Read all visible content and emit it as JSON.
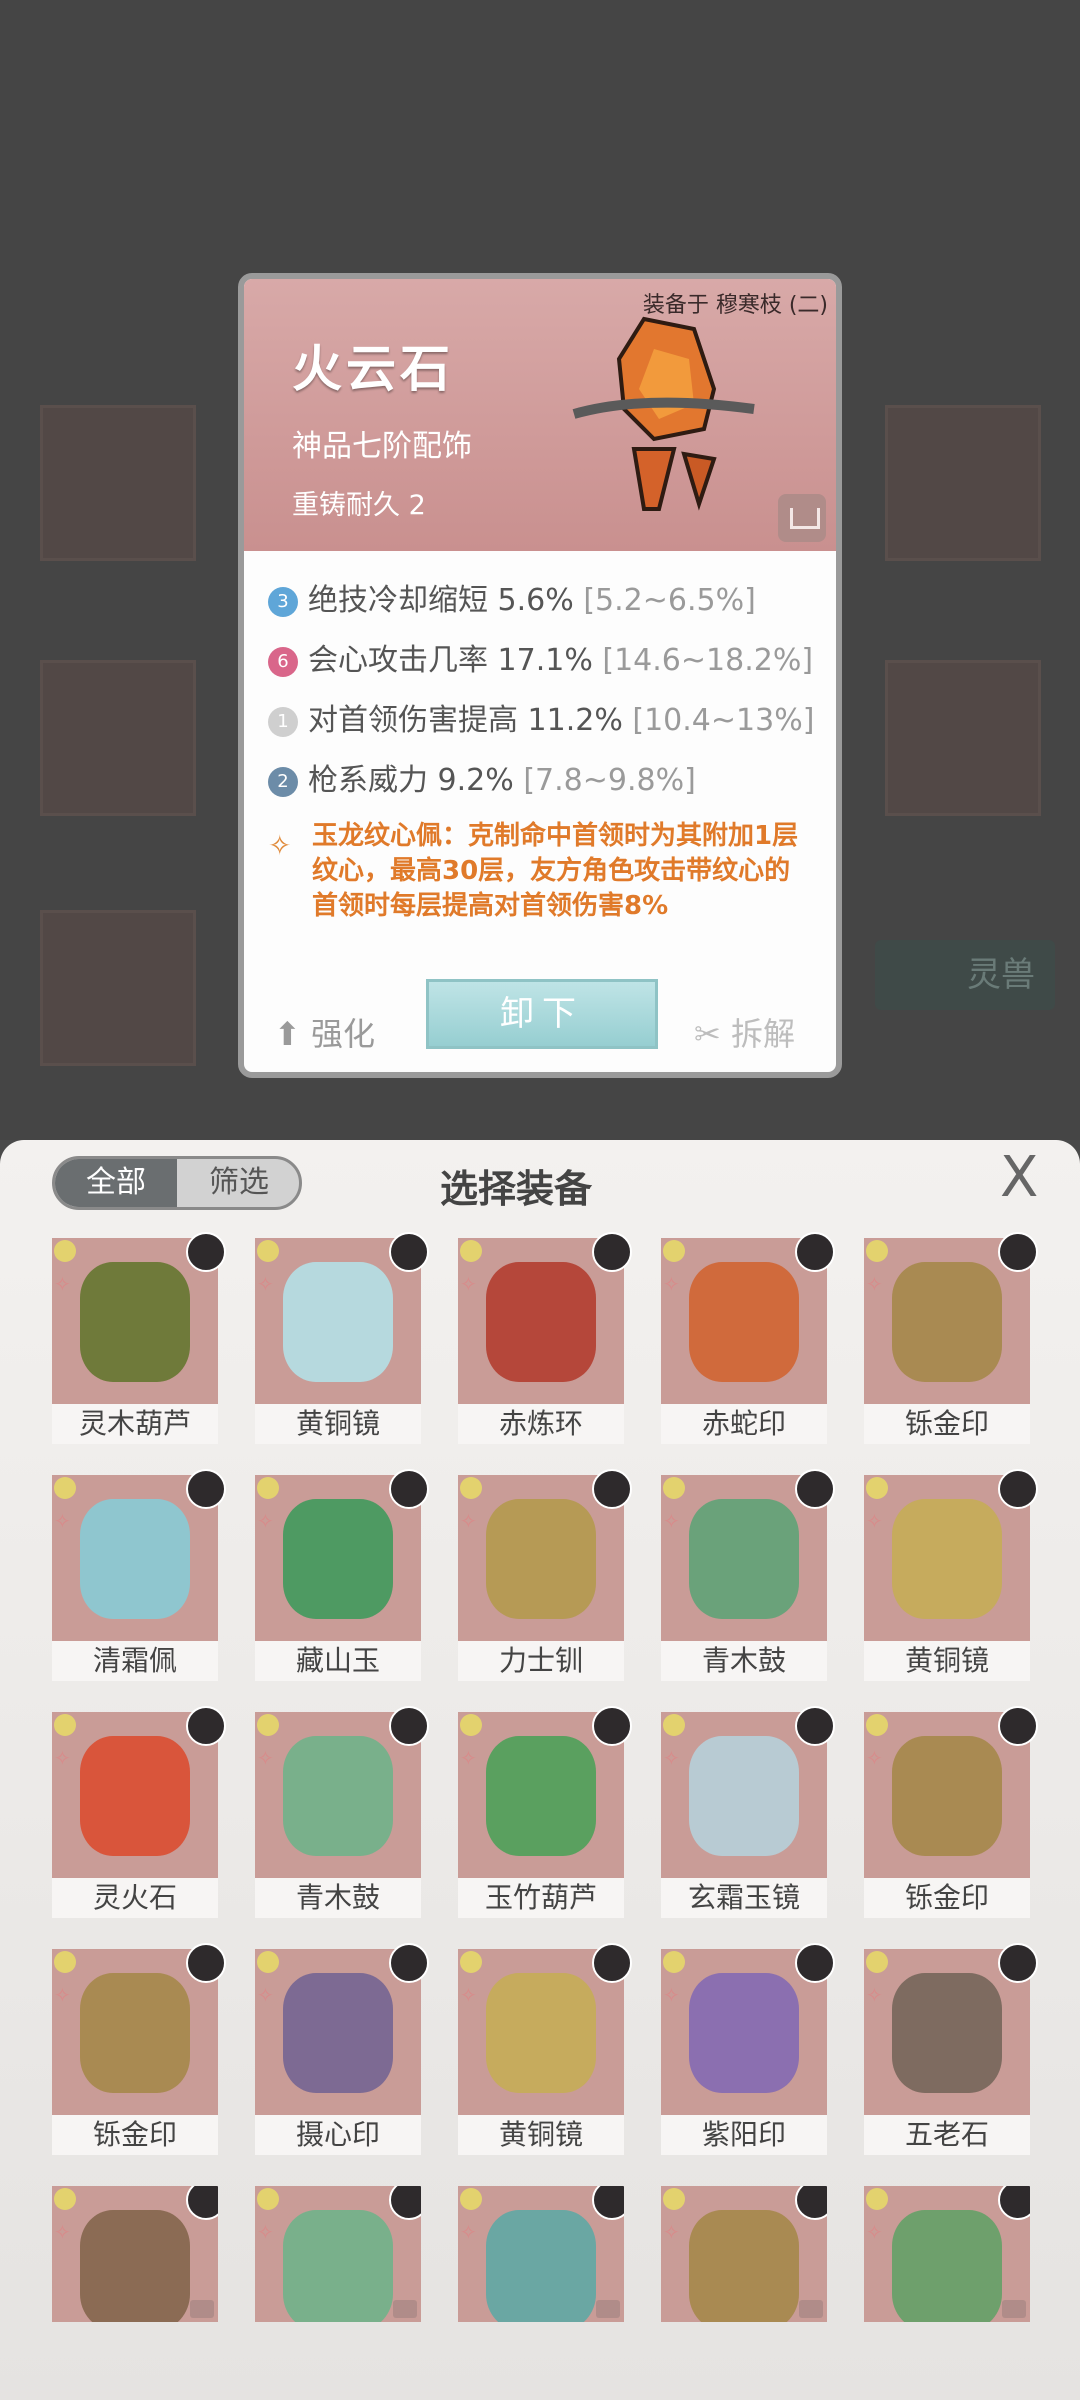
{
  "detail": {
    "equipped_on": "装备于 穆寒枝 (二)",
    "name": "火云石",
    "grade": "神品七阶配饰",
    "durability": "重铸耐久 2",
    "stats": [
      {
        "badge": "3",
        "badge_color": "#5fa6d8",
        "label": "绝技冷却缩短 5.6%",
        "range": "[5.2~6.5%]"
      },
      {
        "badge": "6",
        "badge_color": "#d9668a",
        "label": "会心攻击几率 17.1%",
        "range": "[14.6~18.2%]"
      },
      {
        "badge": "1",
        "badge_color": "#cfcfcf",
        "label": "对首领伤害提高 11.2%",
        "range": "[10.4~13%]"
      },
      {
        "badge": "2",
        "badge_color": "#6c8ca8",
        "label": "枪系威力 9.2%",
        "range": "[7.8~9.8%]"
      }
    ],
    "effect": "玉龙纹心佩：克制命中首领时为其附加1层纹心，最高30层，友方角色攻击带纹心的首领时每层提高对首领伤害8%",
    "strengthen_label": "强化",
    "unequip_label": "卸下",
    "dismantle_label": "拆解"
  },
  "background": {
    "beast_tab": "灵兽"
  },
  "panel": {
    "all_label": "全部",
    "filter_label": "筛选",
    "title": "选择装备",
    "close_label": "X",
    "items": [
      {
        "name": "灵木葫芦",
        "color": "#6f7a3a"
      },
      {
        "name": "黄铜镜",
        "color": "#b6d9de"
      },
      {
        "name": "赤炼环",
        "color": "#b5473a"
      },
      {
        "name": "赤蛇印",
        "color": "#d06a3c"
      },
      {
        "name": "铄金印",
        "color": "#a98a52"
      },
      {
        "name": "清霜佩",
        "color": "#8fc6cf"
      },
      {
        "name": "藏山玉",
        "color": "#4e9a62"
      },
      {
        "name": "力士钏",
        "color": "#b69a55"
      },
      {
        "name": "青木鼓",
        "color": "#6aa27a"
      },
      {
        "name": "黄铜镜",
        "color": "#c6ab5d"
      },
      {
        "name": "灵火石",
        "color": "#d9553b"
      },
      {
        "name": "青木鼓",
        "color": "#79b08b"
      },
      {
        "name": "玉竹葫芦",
        "color": "#5aa05f"
      },
      {
        "name": "玄霜玉镜",
        "color": "#b8cbd3"
      },
      {
        "name": "铄金印",
        "color": "#a98a52"
      },
      {
        "name": "铄金印",
        "color": "#a98a52"
      },
      {
        "name": "摄心印",
        "color": "#7d6a93"
      },
      {
        "name": "黄铜镜",
        "color": "#c6ab5d"
      },
      {
        "name": "紫阳印",
        "color": "#8b6fb0"
      },
      {
        "name": "五老石",
        "color": "#7e6b60"
      },
      {
        "name": "",
        "color": "#8b6b54"
      },
      {
        "name": "",
        "color": "#79b08b"
      },
      {
        "name": "",
        "color": "#6aa7a3"
      },
      {
        "name": "",
        "color": "#a98a52"
      },
      {
        "name": "",
        "color": "#6ea06c"
      }
    ]
  }
}
